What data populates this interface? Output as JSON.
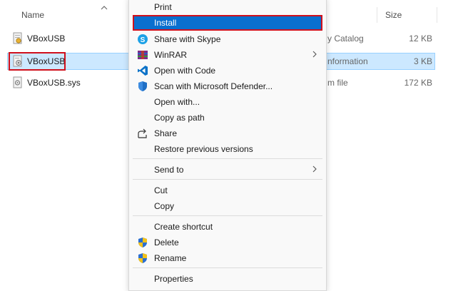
{
  "columns": {
    "name": "Name",
    "size": "Size"
  },
  "files": [
    {
      "name": "VBoxUSB",
      "type": "y Catalog",
      "size": "12 KB",
      "icon": "security-catalog-icon"
    },
    {
      "name": "VBoxUSB",
      "type": "nformation",
      "size": "3 KB",
      "icon": "setup-information-icon",
      "selected": true
    },
    {
      "name": "VBoxUSB.sys",
      "type": "m file",
      "size": "172 KB",
      "icon": "system-file-icon"
    }
  ],
  "menu": {
    "print": "Print",
    "install": "Install",
    "share_skype": "Share with Skype",
    "winrar": "WinRAR",
    "open_code": "Open with Code",
    "defender": "Scan with Microsoft Defender...",
    "open_with": "Open with...",
    "copy_path": "Copy as path",
    "share": "Share",
    "restore": "Restore previous versions",
    "send_to": "Send to",
    "cut": "Cut",
    "copy": "Copy",
    "create_shortcut": "Create shortcut",
    "delete": "Delete",
    "rename": "Rename",
    "properties": "Properties"
  },
  "colors": {
    "highlight": "#0a6fcf",
    "annotation": "#d0101c",
    "selection": "#cce8ff"
  }
}
